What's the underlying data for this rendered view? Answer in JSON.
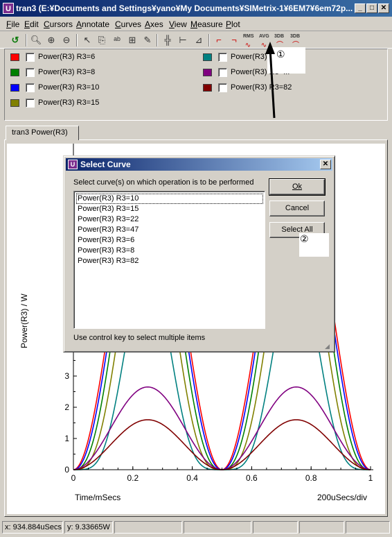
{
  "window": {
    "title": "tran3 (E:¥Documents and Settings¥yano¥My Documents¥SIMetrix-1¥6EM7¥6em72p...",
    "app_icon": "simetrix-icon"
  },
  "menu": [
    "File",
    "Edit",
    "Cursors",
    "Annotate",
    "Curves",
    "Axes",
    "View",
    "Measure",
    "Plot"
  ],
  "toolbar": {
    "rms": "RMS",
    "avg": "AVG",
    "db1": "3DB",
    "db2": "3DB"
  },
  "legend": {
    "items": [
      {
        "label": "Power(R3) R3=6",
        "color": "#ff0000"
      },
      {
        "label": "Power(R3) R3=8",
        "color": "#008000"
      },
      {
        "label": "Power(R3) R3=10",
        "color": "#0000ff"
      },
      {
        "label": "Power(R3) R3=15",
        "color": "#808000"
      },
      {
        "label": "Power(R3) R3=...",
        "color": "#008080"
      },
      {
        "label": "Power(R3) R3=...",
        "color": "#800080"
      },
      {
        "label": "Power(R3) R3=82",
        "color": "#800000"
      }
    ],
    "item2_label": "Power(R3) R3=47"
  },
  "annotations": {
    "one": "①",
    "two": "②"
  },
  "tab": {
    "label": "tran3 Power(R3)"
  },
  "dialog": {
    "title": "Select Curve",
    "instruction": "Select curve(s) on which operation is to be performed",
    "ok": "Ok",
    "cancel": "Cancel",
    "select_all": "Select All",
    "hint": "Use control key to select multiple items",
    "list": [
      "Power(R3) R3=10",
      "Power(R3) R3=15",
      "Power(R3) R3=22",
      "Power(R3) R3=47",
      "Power(R3) R3=6",
      "Power(R3) R3=8",
      "Power(R3) R3=82"
    ]
  },
  "chart_data": {
    "type": "line",
    "xlabel": "Time/mSecs",
    "ylabel": "Power(R3) / W",
    "x_note": "200uSecs/div",
    "xlim": [
      0,
      1
    ],
    "ylim": [
      0,
      10
    ],
    "x_ticks": [
      "0",
      "0.2",
      "0.4",
      "0.6",
      "0.8",
      "1"
    ],
    "y_ticks": [
      "0",
      "1",
      "2",
      "3"
    ],
    "series": [
      {
        "name": "Power(R3) R3=6",
        "color": "#ff0000",
        "peak": 10.0,
        "sharp": 1.0
      },
      {
        "name": "Power(R3) R3=8",
        "color": "#008000",
        "peak": 9.6,
        "sharp": 1.3
      },
      {
        "name": "Power(R3) R3=10",
        "color": "#0000ff",
        "peak": 9.9,
        "sharp": 1.1
      },
      {
        "name": "Power(R3) R3=15",
        "color": "#808000",
        "peak": 8.5,
        "sharp": 1.6
      },
      {
        "name": "Power(R3) R3=22",
        "color": "#008080",
        "peak": 6.5,
        "sharp": 2.2
      },
      {
        "name": "Power(R3) R3=47",
        "color": "#800080",
        "peak": 2.65,
        "sharp": 1.0
      },
      {
        "name": "Power(R3) R3=82",
        "color": "#800000",
        "peak": 1.6,
        "sharp": 1.0
      }
    ]
  },
  "status": {
    "x": "x: 934.884uSecs",
    "y": "y: 9.33665W"
  }
}
